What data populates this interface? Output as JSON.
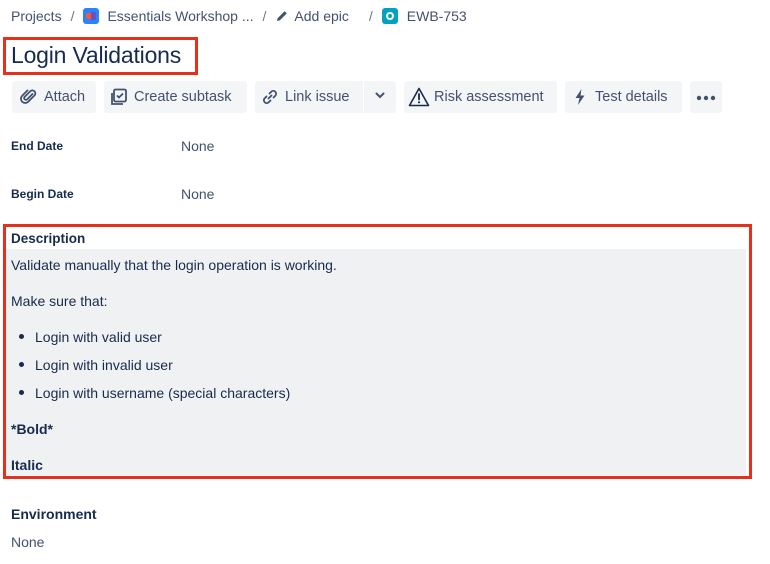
{
  "breadcrumb": {
    "projects": "Projects",
    "project": "Essentials Workshop ...",
    "epic": "Add epic",
    "issue_key": "EWB-753",
    "separator": "/"
  },
  "issue": {
    "title": "Login Validations"
  },
  "toolbar": {
    "attach": "Attach",
    "create_subtask": "Create subtask",
    "link_issue": "Link issue",
    "risk_assessment": "Risk assessment",
    "test_details": "Test details"
  },
  "fields": {
    "end_date": {
      "label": "End Date",
      "value": "None"
    },
    "begin_date": {
      "label": "Begin Date",
      "value": "None"
    }
  },
  "description": {
    "heading": "Description",
    "intro": "Validate manually that the login operation is working.",
    "make_sure": "Make sure that:",
    "items": [
      "Login with valid user",
      "Login with invalid user",
      "Login with username (special characters)"
    ],
    "bold": "*Bold*",
    "italic": "Italic"
  },
  "environment": {
    "label": "Environment",
    "value": "None"
  },
  "colors": {
    "highlight": "#e5301e",
    "description_bg": "#f0f1f3",
    "button_bg": "#f4f5f7",
    "text": "#172b4d"
  }
}
